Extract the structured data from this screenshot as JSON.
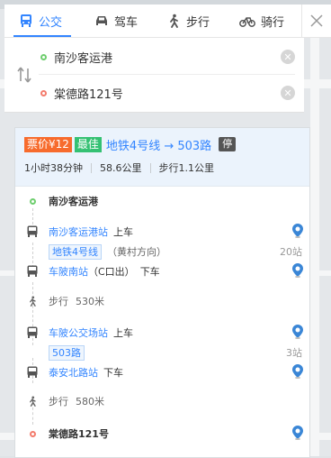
{
  "tabs": [
    {
      "label": "公交",
      "icon": "bus-icon",
      "active": true
    },
    {
      "label": "驾车",
      "icon": "car-icon",
      "active": false
    },
    {
      "label": "步行",
      "icon": "walk-icon",
      "active": false
    },
    {
      "label": "骑行",
      "icon": "bike-icon",
      "active": false
    }
  ],
  "route_inputs": {
    "start": "南沙客运港",
    "end": "棠德路121号"
  },
  "summary": {
    "price_tag": "票价¥12",
    "best_tag": "最佳",
    "route_title": "地铁4号线 → 503路",
    "stop_badge": "停",
    "duration": "1小时38分钟",
    "distance": "58.6公里",
    "walk": "步行1.1公里"
  },
  "steps": {
    "origin": "南沙客运港",
    "s1_station": "南沙客运港站",
    "s1_action": "上车",
    "s1_line": "地铁4号线",
    "s1_direction": "（黄村方向）",
    "s1_count": "20站",
    "s1_off_station": "车陂南站",
    "s1_off_exit": "（C口出）",
    "s1_off_action": "下车",
    "walk1": "步行",
    "walk1_dist": "530米",
    "s2_station": "车陂公交场站",
    "s2_action": "上车",
    "s2_line": "503路",
    "s2_count": "3站",
    "s2_off_station": "泰安北路站",
    "s2_off_action": "下车",
    "walk2": "步行",
    "walk2_dist": "580米",
    "destination": "棠德路121号"
  },
  "colors": {
    "accent": "#3385ff",
    "price": "#f76b2d",
    "best": "#34c173",
    "start_dot": "#6fce6f",
    "end_dot": "#f37c6d"
  }
}
